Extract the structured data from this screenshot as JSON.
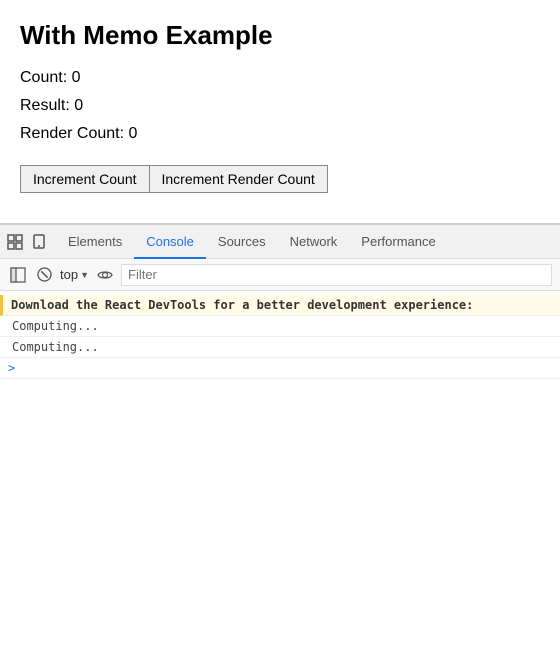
{
  "app": {
    "title": "With Memo Example",
    "count_label": "Count: 0",
    "result_label": "Result: 0",
    "render_count_label": "Render Count: 0",
    "btn_increment": "Increment Count",
    "btn_increment_render": "Increment Render Count"
  },
  "devtools": {
    "tabs": [
      {
        "label": "Elements",
        "active": false
      },
      {
        "label": "Console",
        "active": true
      },
      {
        "label": "Sources",
        "active": false
      },
      {
        "label": "Network",
        "active": false
      },
      {
        "label": "Performance",
        "active": false
      }
    ],
    "context": "top",
    "filter_placeholder": "Filter",
    "console_lines": [
      {
        "type": "warning",
        "text": "Download the React DevTools for a better development experience:"
      },
      {
        "type": "log",
        "text": "Computing..."
      },
      {
        "type": "log",
        "text": "Computing..."
      },
      {
        "type": "prompt",
        "text": ">"
      }
    ]
  },
  "icons": {
    "devtools_inspect": "⬚",
    "devtools_device": "⬜",
    "clear_console": "🚫",
    "eye": "👁"
  }
}
